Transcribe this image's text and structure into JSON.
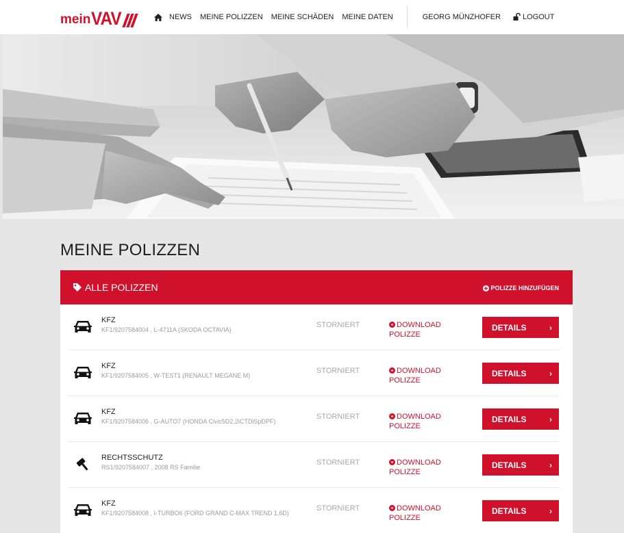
{
  "brand": {
    "prefix": "mein",
    "name": "VAV",
    "color": "#d0112b"
  },
  "nav": {
    "items": [
      {
        "label": "NEWS"
      },
      {
        "label": "MEINE POLIZZEN"
      },
      {
        "label": "MEINE SCHÄDEN"
      },
      {
        "label": "MEINE DATEN"
      }
    ],
    "user": "GEORG MÜNZHOFER",
    "logout": "LOGOUT"
  },
  "page": {
    "title": "MEINE POLIZZEN"
  },
  "panel": {
    "title": "ALLE POLIZZEN",
    "add_label": "POLIZZE HINZUFÜGEN",
    "details_label": "DETAILS",
    "download_label": "DOWNLOAD POLIZZE"
  },
  "policies": [
    {
      "icon": "car-icon",
      "kind": "KFZ",
      "ident": "KF1/9207584004 , L-4711A (SKODA OCTAVIA)",
      "status": "STORNIERT"
    },
    {
      "icon": "car-icon",
      "kind": "KFZ",
      "ident": "KF1/9207584005 , W-TEST1 (RENAULT MEGANE M)",
      "status": "STORNIERT"
    },
    {
      "icon": "car-icon",
      "kind": "KFZ",
      "ident": "KF1/9207584006 , G-AUTO7 (HONDA Civic5D2,2iCTDiSpDPF)",
      "status": "STORNIERT"
    },
    {
      "icon": "gavel-icon",
      "kind": "RECHTSSCHUTZ",
      "ident": "RS1/9207584007 , 2008 RS Familie",
      "status": "STORNIERT"
    },
    {
      "icon": "car-icon",
      "kind": "KFZ",
      "ident": "KF1/9207584008 , I-TURBO6 (FORD GRAND C-MAX TREND 1,6D)",
      "status": "STORNIERT"
    }
  ]
}
